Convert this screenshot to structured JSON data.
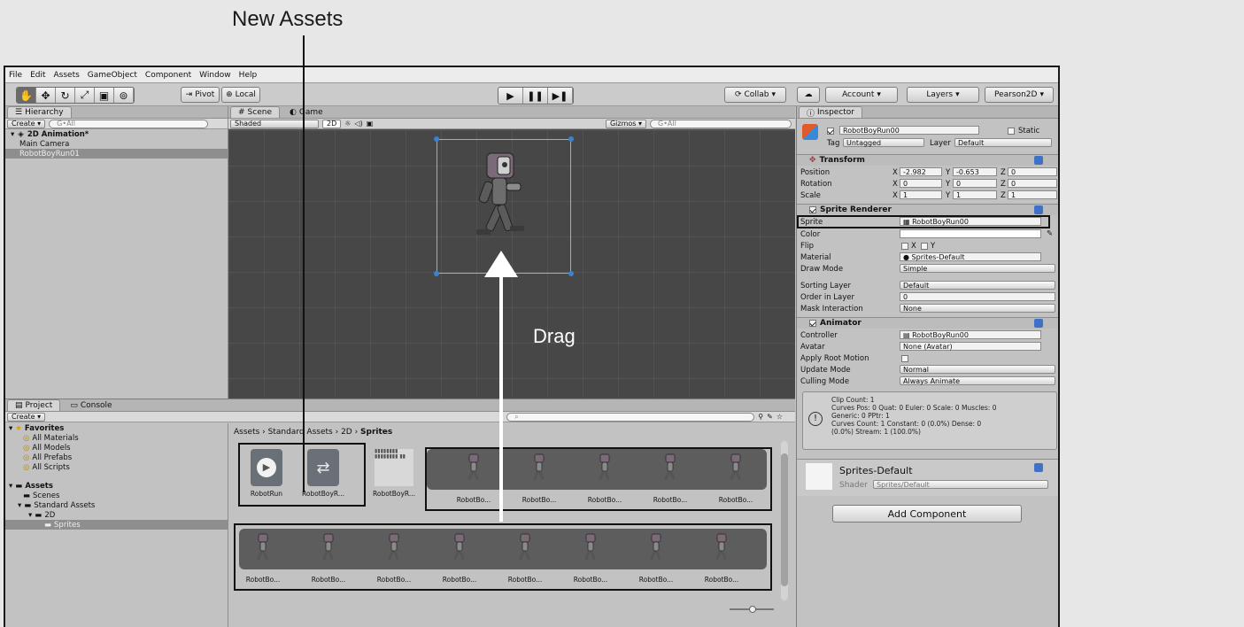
{
  "annotations": {
    "new_assets": "New Assets",
    "drag": "Drag"
  },
  "menu": [
    "File",
    "Edit",
    "Assets",
    "GameObject",
    "Component",
    "Window",
    "Help"
  ],
  "toolbar": {
    "pivot": "Pivot",
    "local": "Local",
    "collab": "Collab",
    "account": "Account",
    "layers": "Layers",
    "layout": "Pearson2D"
  },
  "hierarchy": {
    "tab": "Hierarchy",
    "create": "Create",
    "search": "G•All",
    "scene": "2D Animation*",
    "items": [
      "Main Camera",
      "RobotBoyRun01"
    ]
  },
  "scene": {
    "scene_tab": "Scene",
    "game_tab": "Game",
    "shading": "Shaded",
    "mode_2d": "2D",
    "gizmos": "Gizmos",
    "search": "G•All"
  },
  "inspector": {
    "tab": "Inspector",
    "object_name": "RobotBoyRun00",
    "static": "Static",
    "tag_label": "Tag",
    "tag_value": "Untagged",
    "layer_label": "Layer",
    "layer_value": "Default",
    "transform": {
      "title": "Transform",
      "position_label": "Position",
      "pos_x": "-2.982",
      "pos_y": "-0.653",
      "pos_z": "0",
      "rotation_label": "Rotation",
      "rot_x": "0",
      "rot_y": "0",
      "rot_z": "0",
      "scale_label": "Scale",
      "scale_x": "1",
      "scale_y": "1",
      "scale_z": "1"
    },
    "sprite_renderer": {
      "title": "Sprite Renderer",
      "sprite_label": "Sprite",
      "sprite_value": "RobotBoyRun00",
      "color_label": "Color",
      "flip_label": "Flip",
      "flip_x": "X",
      "flip_y": "Y",
      "material_label": "Material",
      "material_value": "Sprites-Default",
      "draw_mode_label": "Draw Mode",
      "draw_mode_value": "Simple",
      "sorting_layer_label": "Sorting Layer",
      "sorting_layer_value": "Default",
      "order_label": "Order in Layer",
      "order_value": "0",
      "mask_label": "Mask Interaction",
      "mask_value": "None"
    },
    "animator": {
      "title": "Animator",
      "controller_label": "Controller",
      "controller_value": "RobotBoyRun00",
      "avatar_label": "Avatar",
      "avatar_value": "None (Avatar)",
      "root_motion_label": "Apply Root Motion",
      "update_label": "Update Mode",
      "update_value": "Normal",
      "culling_label": "Culling Mode",
      "culling_value": "Always Animate",
      "info_line1": "Clip Count: 1",
      "info_line2": "Curves Pos: 0 Quat: 0 Euler: 0 Scale: 0 Muscles: 0",
      "info_line3": "Generic: 0 PPtr: 1",
      "info_line4": "Curves Count: 1 Constant: 0 (0.0%) Dense: 0",
      "info_line5": "(0.0%) Stream: 1 (100.0%)"
    },
    "material": {
      "name": "Sprites-Default",
      "shader_label": "Shader",
      "shader_value": "Sprites/Default"
    },
    "add_component": "Add Component"
  },
  "project": {
    "tab": "Project",
    "console_tab": "Console",
    "create": "Create",
    "favorites": "Favorites",
    "fav_items": [
      "All Materials",
      "All Models",
      "All Prefabs",
      "All Scripts"
    ],
    "assets": "Assets",
    "tree": [
      "Scenes",
      "Standard Assets",
      "2D",
      "Sprites"
    ],
    "breadcrumb_1": "Assets",
    "breadcrumb_2": "Standard Assets",
    "breadcrumb_3": "2D",
    "breadcrumb_4": "Sprites",
    "new_assets": [
      "RobotRun",
      "RobotBoyR..."
    ],
    "sheet_label": "RobotBoyR...",
    "row1_labels": [
      "RobotBo...",
      "RobotBo...",
      "RobotBo...",
      "RobotBo...",
      "RobotBo..."
    ],
    "row2_labels": [
      "RobotBo...",
      "RobotBo...",
      "RobotBo...",
      "RobotBo...",
      "RobotBo...",
      "RobotBo...",
      "RobotBo...",
      "RobotBo..."
    ]
  }
}
